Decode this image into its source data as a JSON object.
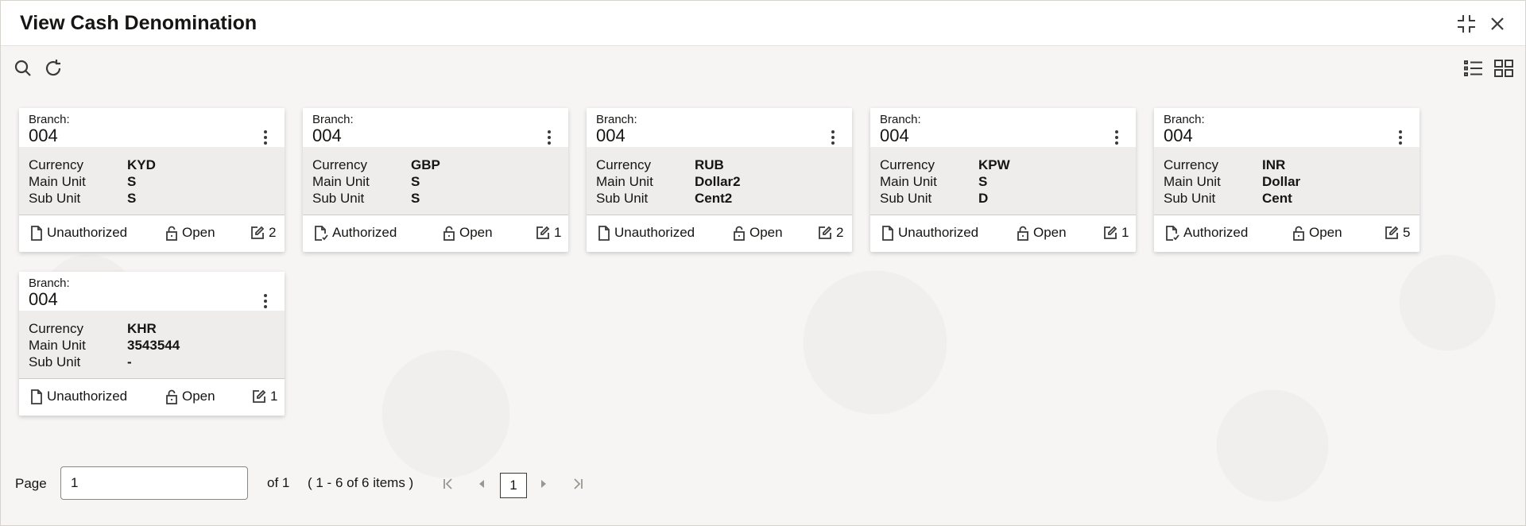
{
  "window": {
    "title": "View Cash Denomination"
  },
  "header_icons": [
    "compress-icon",
    "close-icon"
  ],
  "toolbar": {
    "left_icons": [
      "search-icon",
      "refresh-icon"
    ],
    "right_icons": [
      "list-view-icon",
      "grid-view-icon"
    ]
  },
  "cards": [
    {
      "branch_label": "Branch:",
      "branch": "004",
      "currency_label": "Currency",
      "currency": "KYD",
      "main_unit_label": "Main Unit",
      "main_unit": "S",
      "sub_unit_label": "Sub Unit",
      "sub_unit": "S",
      "auth_status": "Unauthorized",
      "record_status": "Open",
      "modification_count": "2"
    },
    {
      "branch_label": "Branch:",
      "branch": "004",
      "currency_label": "Currency",
      "currency": "GBP",
      "main_unit_label": "Main Unit",
      "main_unit": "S",
      "sub_unit_label": "Sub Unit",
      "sub_unit": "S",
      "auth_status": "Authorized",
      "record_status": "Open",
      "modification_count": "1"
    },
    {
      "branch_label": "Branch:",
      "branch": "004",
      "currency_label": "Currency",
      "currency": "RUB",
      "main_unit_label": "Main Unit",
      "main_unit": "Dollar2",
      "sub_unit_label": "Sub Unit",
      "sub_unit": "Cent2",
      "auth_status": "Unauthorized",
      "record_status": "Open",
      "modification_count": "2"
    },
    {
      "branch_label": "Branch:",
      "branch": "004",
      "currency_label": "Currency",
      "currency": "KPW",
      "main_unit_label": "Main Unit",
      "main_unit": "S",
      "sub_unit_label": "Sub Unit",
      "sub_unit": "D",
      "auth_status": "Unauthorized",
      "record_status": "Open",
      "modification_count": "1"
    },
    {
      "branch_label": "Branch:",
      "branch": "004",
      "currency_label": "Currency",
      "currency": "INR",
      "main_unit_label": "Main Unit",
      "main_unit": "Dollar",
      "sub_unit_label": "Sub Unit",
      "sub_unit": "Cent",
      "auth_status": "Authorized",
      "record_status": "Open",
      "modification_count": "5"
    },
    {
      "branch_label": "Branch:",
      "branch": "004",
      "currency_label": "Currency",
      "currency": "KHR",
      "main_unit_label": "Main Unit",
      "main_unit": "3543544",
      "sub_unit_label": "Sub Unit",
      "sub_unit": "-",
      "auth_status": "Unauthorized",
      "record_status": "Open",
      "modification_count": "1"
    }
  ],
  "pagination": {
    "page_label": "Page",
    "page_value": "1",
    "of_label": "of 1",
    "items_label": "( 1 - 6 of 6 items )",
    "current_page": "1"
  }
}
